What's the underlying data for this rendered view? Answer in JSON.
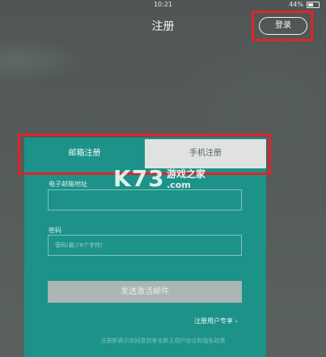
{
  "status_bar": {
    "time": "10:21",
    "battery": "44%"
  },
  "header": {
    "title": "注册",
    "login_label": "登录"
  },
  "tabs": [
    {
      "label": "邮箱注册"
    },
    {
      "label": "手机注册"
    }
  ],
  "form": {
    "email_label": "电子邮箱地址",
    "email_placeholder": "",
    "password_label": "密码",
    "password_placeholder": "密码(最少6个字符)",
    "submit_label": "发送激活邮件"
  },
  "links": {
    "user_terms": "注册用户专享 ›"
  },
  "footer": {
    "note": "注册即表示你同意到掌全新王用户协议和隐私政策"
  },
  "watermark": {
    "logo": "K73",
    "name": "游戏之家",
    "domain": ".com"
  },
  "colors": {
    "accent": "#1d9288",
    "highlight_box": "#e1232a",
    "selected_tab": "#dfe2e1"
  }
}
